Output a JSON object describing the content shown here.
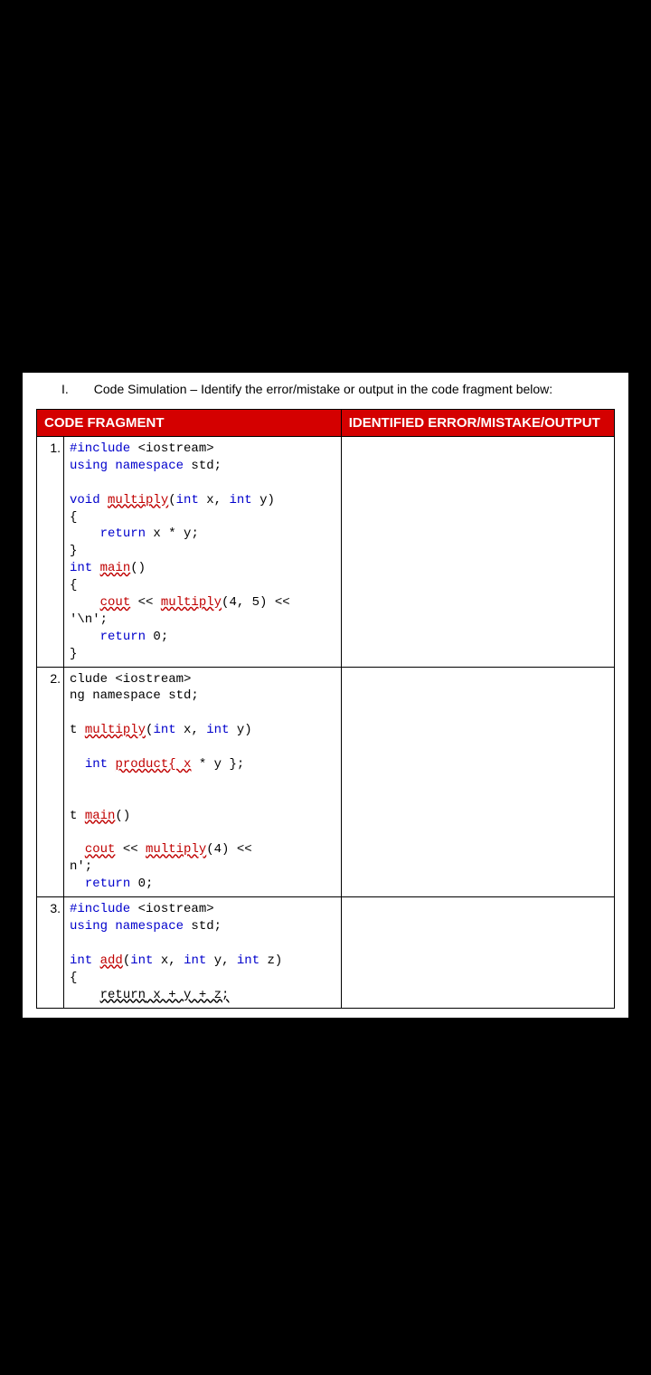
{
  "instruction": {
    "roman": "I.",
    "text": "Code Simulation – Identify the error/mistake or output in the code fragment below:"
  },
  "headers": {
    "col1": "CODE FRAGMENT",
    "col2": "IDENTIFIED ERROR/MISTAKE/OUTPUT"
  },
  "rows": [
    {
      "num": "1.",
      "code": {
        "l1a": "#include",
        "l1b": " <iostream>",
        "l2a": "using namespace",
        "l2b": " std;",
        "l3": "",
        "l4a": "void",
        "l4b": " ",
        "l4c": "multiply",
        "l4d": "(",
        "l4e": "int",
        "l4f": " x, ",
        "l4g": "int",
        "l4h": " y)",
        "l5": "{",
        "l6a": "    ",
        "l6b": "return",
        "l6c": " x * y;",
        "l7": "}",
        "l8a": "int",
        "l8b": " ",
        "l8c": "main",
        "l8d": "()",
        "l9": "{",
        "l10a": "    ",
        "l10b": "cout",
        "l10c": " << ",
        "l10d": "multiply",
        "l10e": "(4, 5) << ",
        "l10f": "'\\n'",
        "l10g": ";",
        "l11a": "    ",
        "l11b": "return",
        "l11c": " 0;",
        "l12": "}"
      },
      "answer": ""
    },
    {
      "num": "2.",
      "code": {
        "l1": "clude <iostream>",
        "l2": "ng namespace std;",
        "l3": "",
        "l4a": "t ",
        "l4b": "multiply",
        "l4c": "(",
        "l4d": "int",
        "l4e": " x, ",
        "l4f": "int",
        "l4g": " y)",
        "l5": "",
        "l6a": "  ",
        "l6b": "int",
        "l6c": " ",
        "l6d": "product{ x",
        "l6e": " * y };",
        "l7": "",
        "l8": "",
        "l9a": "t ",
        "l9b": "main",
        "l9c": "()",
        "l10": "",
        "l11a": "  ",
        "l11b": "cout",
        "l11c": " << ",
        "l11d": "multiply",
        "l11e": "(4) << ",
        "l12": "n';",
        "l13a": "  ",
        "l13b": "return",
        "l13c": " 0;"
      },
      "answer": ""
    },
    {
      "num": "3.",
      "code": {
        "l1a": "#include",
        "l1b": " <iostream>",
        "l2a": "using namespace",
        "l2b": " std;",
        "l3": "",
        "l4a": "int",
        "l4b": " ",
        "l4c": "add",
        "l4d": "(",
        "l4e": "int",
        "l4f": " x, ",
        "l4g": "int",
        "l4h": " y, ",
        "l4i": "int",
        "l4j": " z)",
        "l5": "{",
        "l6a": "    ",
        "l6b": "return",
        "l6c": " x + y + z;"
      },
      "answer": ""
    }
  ]
}
